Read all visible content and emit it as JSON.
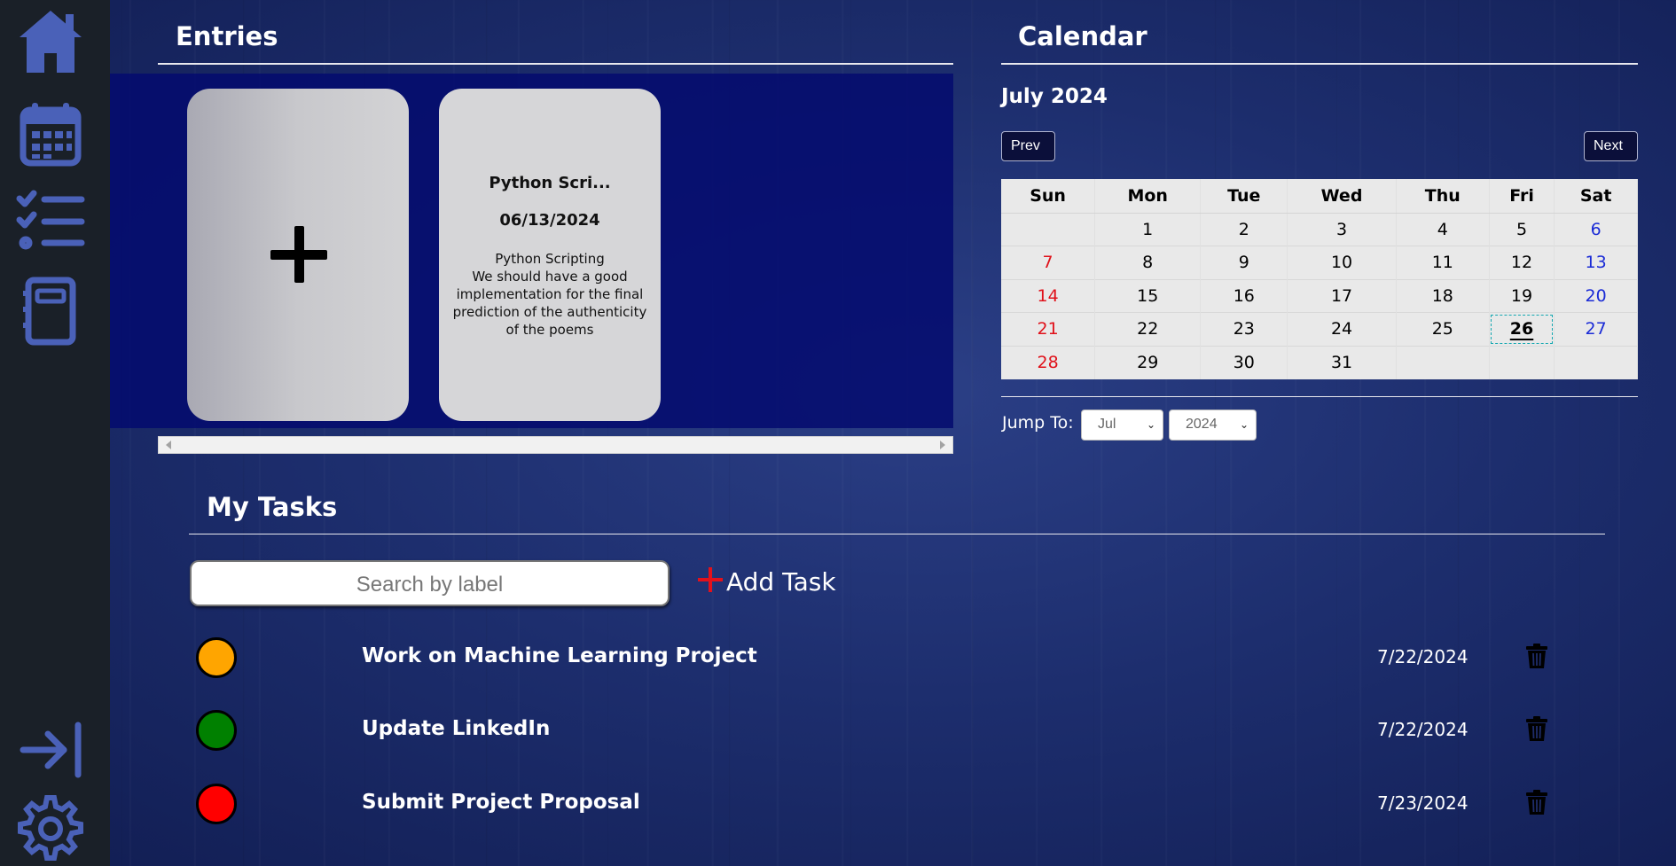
{
  "sidebar": {
    "icons": [
      "home-icon",
      "calendar-icon",
      "checklist-icon",
      "notebook-icon",
      "logout-icon",
      "gear-icon"
    ]
  },
  "colors": {
    "sidebar_bg": "#1a2028",
    "icon": "#4a61b8",
    "priority_high": "#ff0000",
    "priority_medium": "#ffa500",
    "priority_low": "#008000",
    "add_plus": "#e3111b"
  },
  "entries": {
    "title": "Entries",
    "cards": [
      {
        "title": "Python Scri...",
        "date": "06/13/2024",
        "body_lines": [
          "Python Scripting",
          "We should have a good",
          "implementation for the final",
          "prediction of the authenticity",
          "of the poems"
        ]
      }
    ]
  },
  "calendar": {
    "title": "Calendar",
    "month_label": "July 2024",
    "prev_label": "Prev",
    "next_label": "Next",
    "weekdays": [
      "Sun",
      "Mon",
      "Tue",
      "Wed",
      "Thu",
      "Fri",
      "Sat"
    ],
    "weeks": [
      [
        "",
        "1",
        "2",
        "3",
        "4",
        "5",
        "6"
      ],
      [
        "7",
        "8",
        "9",
        "10",
        "11",
        "12",
        "13"
      ],
      [
        "14",
        "15",
        "16",
        "17",
        "18",
        "19",
        "20"
      ],
      [
        "21",
        "22",
        "23",
        "24",
        "25",
        "26",
        "27"
      ],
      [
        "28",
        "29",
        "30",
        "31",
        "",
        "",
        ""
      ]
    ],
    "today": "26",
    "jump_label": "Jump To:",
    "jump_month": "Jul",
    "jump_year": "2024"
  },
  "tasks": {
    "title": "My Tasks",
    "search_placeholder": "Search by label",
    "add_label": "Add Task",
    "items": [
      {
        "name": "Work on Machine Learning Project",
        "date": "7/22/2024",
        "priority_color": "#ffa500"
      },
      {
        "name": "Update LinkedIn",
        "date": "7/22/2024",
        "priority_color": "#008000"
      },
      {
        "name": "Submit Project Proposal",
        "date": "7/23/2024",
        "priority_color": "#ff0000"
      }
    ]
  }
}
